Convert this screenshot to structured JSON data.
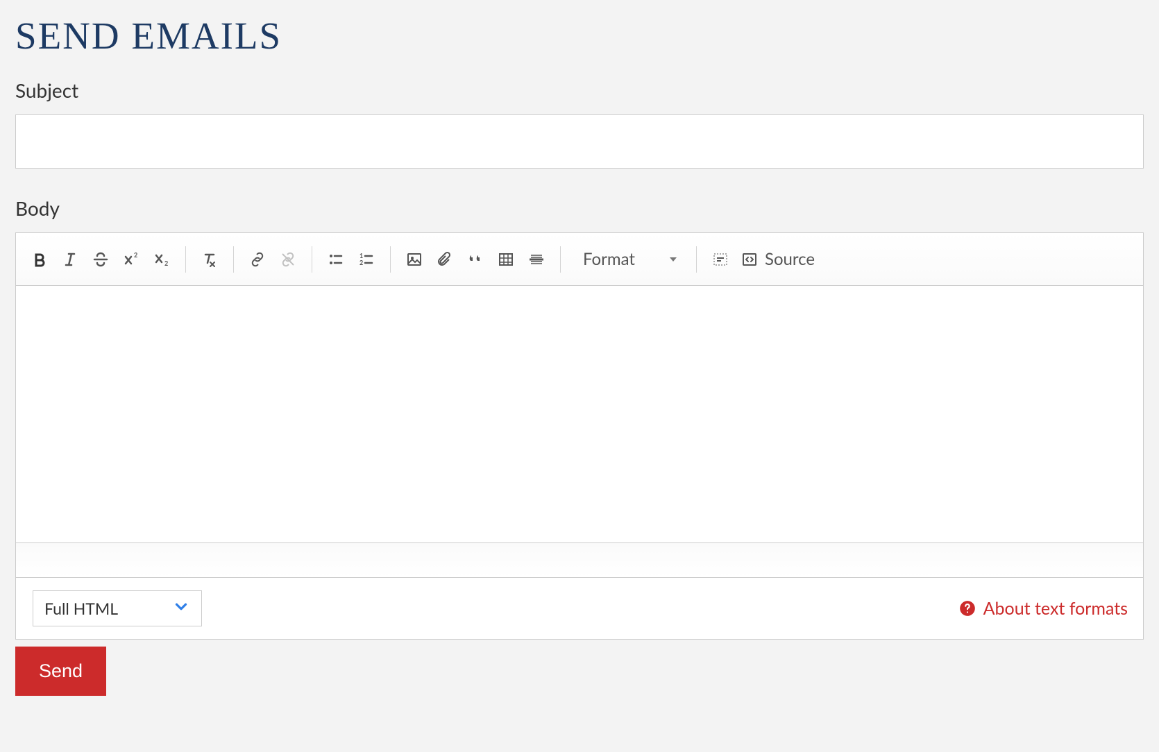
{
  "page": {
    "title": "SEND EMAILS"
  },
  "subject": {
    "label": "Subject",
    "value": ""
  },
  "body": {
    "label": "Body",
    "value": ""
  },
  "toolbar": {
    "format_label": "Format",
    "source_label": "Source"
  },
  "format_select": {
    "selected": "Full HTML"
  },
  "about_link": {
    "label": "About text formats"
  },
  "buttons": {
    "send": "Send"
  }
}
